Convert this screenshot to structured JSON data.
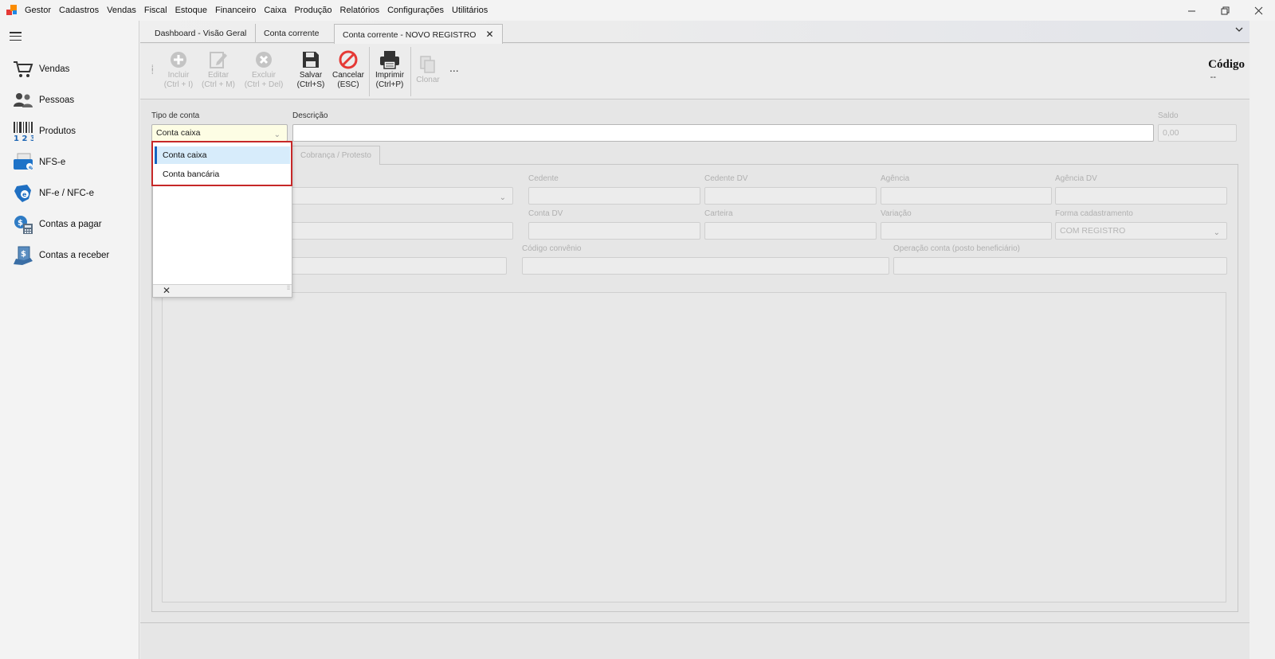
{
  "menu": {
    "items": [
      "Gestor",
      "Cadastros",
      "Vendas",
      "Fiscal",
      "Estoque",
      "Financeiro",
      "Caixa",
      "Produção",
      "Relatórios",
      "Configurações",
      "Utilitários"
    ]
  },
  "window": {
    "minimize_icon": "minimize-icon",
    "restore_icon": "restore-icon",
    "close_icon": "close-icon"
  },
  "sidebar": {
    "items": [
      {
        "label": "Vendas",
        "icon": "cart-icon"
      },
      {
        "label": "Pessoas",
        "icon": "people-icon"
      },
      {
        "label": "Produtos",
        "icon": "barcode-icon"
      },
      {
        "label": "NFS-e",
        "icon": "nfse-icon"
      },
      {
        "label": "NF-e / NFC-e",
        "icon": "nfe-icon"
      },
      {
        "label": "Contas a pagar",
        "icon": "bills-pay-icon"
      },
      {
        "label": "Contas a receber",
        "icon": "bills-receive-icon"
      }
    ]
  },
  "tabs": [
    {
      "label": "Dashboard - Visão Geral"
    },
    {
      "label": "Conta corrente"
    },
    {
      "label": "Conta corrente - NOVO REGISTRO",
      "active": true
    }
  ],
  "toolbar": {
    "incluir": {
      "line1": "Incluir",
      "line2": "(Ctrl + I)"
    },
    "editar": {
      "line1": "Editar",
      "line2": "(Ctrl + M)"
    },
    "excluir": {
      "line1": "Excluir",
      "line2": "(Ctrl + Del)"
    },
    "salvar": {
      "line1": "Salvar",
      "line2": "(Ctrl+S)"
    },
    "cancelar": {
      "line1": "Cancelar",
      "line2": "(ESC)"
    },
    "imprimir": {
      "line1": "Imprimir",
      "line2": "(Ctrl+P)"
    },
    "clonar": {
      "line1": "Clonar"
    },
    "more": "..."
  },
  "header": {
    "codigo_label": "Código",
    "codigo_value": "--"
  },
  "form": {
    "tipo_conta_label": "Tipo de conta",
    "tipo_conta_value": "Conta caixa",
    "descricao_label": "Descrição",
    "descricao_value": "",
    "saldo_label": "Saldo",
    "saldo_value": "0,00",
    "subtab_label": "Cobrança / Protesto",
    "cedente_label": "Cedente",
    "cedente_dv_label": "Cedente DV",
    "agencia_label": "Agência",
    "agencia_dv_label": "Agência DV",
    "conta_dv_label": "Conta DV",
    "carteira_label": "Carteira",
    "variacao_label": "Variação",
    "forma_cadastramento_label": "Forma cadastramento",
    "forma_cadastramento_value": "COM REGISTRO",
    "codigo_convenio_label": "Código convênio",
    "operacao_conta_label": "Operação conta (posto beneficiário)"
  },
  "dropdown": {
    "options": [
      "Conta caixa",
      "Conta bancária"
    ],
    "selected": "Conta caixa",
    "close_symbol": "✕"
  },
  "colors": {
    "accent": "#1565c0",
    "highlight_border": "#c62828",
    "cancel_red": "#e53935",
    "selected_bg": "#d7ecfb"
  }
}
